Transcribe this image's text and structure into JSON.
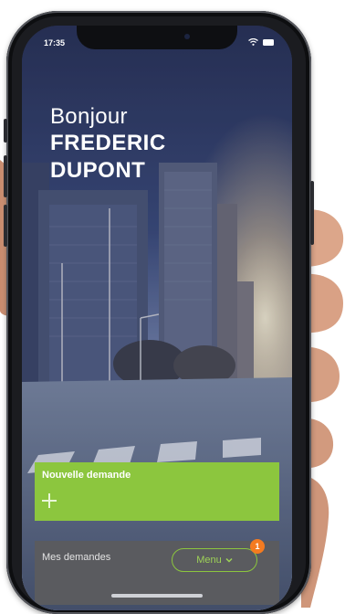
{
  "status": {
    "time": "17:35"
  },
  "greeting": {
    "hello": "Bonjour",
    "first_name": "FREDERIC",
    "last_name": "DUPONT"
  },
  "new_request": {
    "label": "Nouvelle demande",
    "icon": "plus-icon"
  },
  "bottom": {
    "title": "Mes demandes",
    "menu_label": "Menu",
    "menu_icon": "chevron-down-icon",
    "badge_count": "1"
  },
  "colors": {
    "accent_green": "#8cc63e",
    "badge_orange": "#f47b20",
    "bar_gray": "#5a5b5f"
  }
}
